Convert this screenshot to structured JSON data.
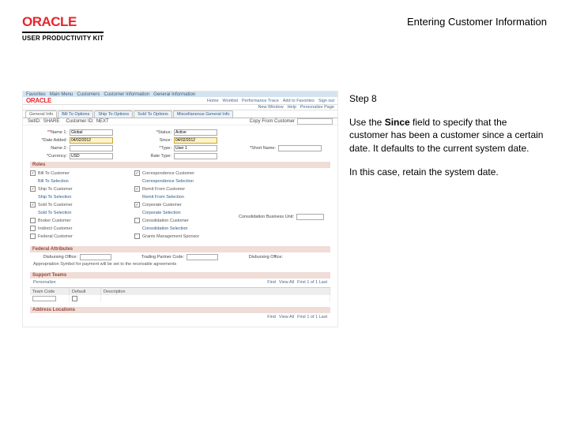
{
  "header": {
    "brand_logo": "ORACLE",
    "brand_sub": "USER PRODUCTIVITY KIT",
    "page_title": "Entering Customer Information"
  },
  "instructions": {
    "step_label": "Step 8",
    "para1_a": "Use the ",
    "para1_b": "Since",
    "para1_c": " field to specify that the customer has been a customer since a certain date. It defaults to the current system date.",
    "para2": "In this case, retain the system date."
  },
  "screenshot": {
    "topnav": {
      "menu": [
        "Favorites",
        "Main Menu",
        "Customers",
        "Customer Information",
        "General Information"
      ],
      "right": [
        "Home",
        "Worklist",
        "Performance Trace",
        "Add to Favorites",
        "Sign out"
      ]
    },
    "subhead": [
      "New Window",
      "Help",
      "Personalize Page"
    ],
    "inner_tabs": [
      "General Info",
      "Bill To Options",
      "Ship To Options",
      "Sold To Options",
      "Miscellaneous General Info"
    ],
    "idline": {
      "setid_lbl": "SetID:",
      "setid_val": "SHARE",
      "cust_lbl": "Customer ID:",
      "cust_val": "NEXT",
      "copy_lbl": "Copy From Customer"
    },
    "form": {
      "row1": {
        "name_lbl": "*Name 1:",
        "name_val": "Global",
        "since_lbl": "*Date Added:",
        "since_val": "04/02/2012",
        "status_lbl": "*Status:",
        "status_val": "Active",
        "name2_lbl": "Name 2:",
        "name2_val": "",
        "type_lbl": "*Type:",
        "type_val": "User 1",
        "since2_lbl": "Since:",
        "since2_val": "04/02/2012",
        "short_lbl": "*Short Name:",
        "short_val": "",
        "cur_lbl": "*Currency:",
        "cur_val": "USD",
        "rate_lbl": "Rate Type:",
        "rate_val": ""
      },
      "roles_title": "Roles",
      "roles": {
        "left": [
          "Bill To Customer",
          "Ship To Customer",
          "Sold To Customer",
          "Broker Customer",
          "Indirect Customer",
          "Federal Customer"
        ],
        "mid": [
          "Correspondence Customer",
          "Remit From Customer",
          "Corporate Customer",
          "Consolidation Customer",
          "Grants Management Sponsor"
        ],
        "right_lbl": "Consolidation Business Unit:",
        "left_details": [
          "Bill To Selection",
          "Ship To Selection",
          "Sold To Selection"
        ],
        "mid_details": [
          "Correspondence Selection",
          "Remit From Selection",
          "Corporate Selection",
          "Consolidation Selection"
        ]
      },
      "fed_title": "Federal Attributes",
      "fed": {
        "l1": "Disbursing Office:",
        "l2": "Trading Partner Code:",
        "l3": "Appropriation Symbol for payment will be set to the receivable agreements"
      },
      "sup_title": "Support Teams",
      "sup_nav": {
        "personalize": "Personalize",
        "find": "Find",
        "view": "View All",
        "count": "First 1 of 1 Last"
      },
      "sup_cols": [
        "Team Code",
        "Default",
        "Description"
      ],
      "addr_title": "Address Locations",
      "addr_nav": {
        "find": "Find",
        "view": "View All",
        "count": "First 1 of 1 Last"
      }
    }
  }
}
